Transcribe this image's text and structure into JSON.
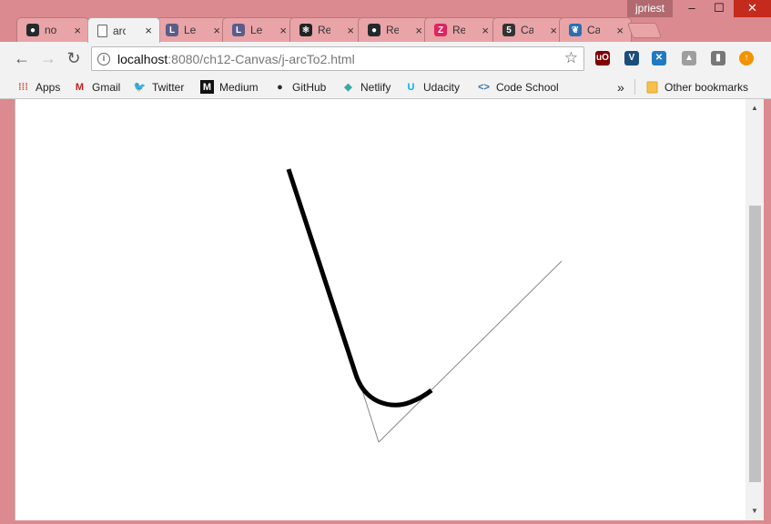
{
  "window": {
    "user": "jpriest",
    "minimize_glyph": "‒",
    "maximize_glyph": "☐",
    "close_glyph": "✕"
  },
  "tabs": [
    {
      "label": "no",
      "icon": "github-icon",
      "color": "#24292e",
      "glyph": "●",
      "active": false
    },
    {
      "label": "arc",
      "icon": "page-icon",
      "color": "#ffffff",
      "glyph": "",
      "active": true
    },
    {
      "label": "Le",
      "icon": "lesson-icon",
      "color": "#5c5c8a",
      "glyph": "L",
      "active": false
    },
    {
      "label": "Le",
      "icon": "lesson-icon",
      "color": "#5c5c8a",
      "glyph": "L",
      "active": false
    },
    {
      "label": "Re",
      "icon": "react-icon",
      "color": "#222222",
      "glyph": "⚛",
      "active": false
    },
    {
      "label": "Re",
      "icon": "github-icon",
      "color": "#24292e",
      "glyph": "●",
      "active": false
    },
    {
      "label": "Re",
      "icon": "nz-icon",
      "color": "#e0245e",
      "glyph": "Z",
      "active": false
    },
    {
      "label": "Ca",
      "icon": "five-icon",
      "color": "#333333",
      "glyph": "5",
      "active": false
    },
    {
      "label": "Ca",
      "icon": "bird-icon",
      "color": "#2a6fb0",
      "glyph": "❦",
      "active": false
    }
  ],
  "tab_close_glyph": "×",
  "toolbar": {
    "back": "←",
    "forward": "→",
    "reload": "↻",
    "url_host": "localhost",
    "url_rest": ":8080/ch12-Canvas/j-arcTo2.html",
    "info": "i",
    "star": "☆",
    "extensions": [
      {
        "name": "ublock-icon",
        "color": "#800000",
        "glyph": "uO"
      },
      {
        "name": "vue-devtools-icon",
        "color": "#1a4d7a",
        "glyph": "V"
      },
      {
        "name": "xcode-icon",
        "color": "#1f7ac2",
        "glyph": "✕"
      },
      {
        "name": "drive-icon",
        "color": "#9e9e9e",
        "glyph": "▲"
      },
      {
        "name": "page-action-icon",
        "color": "#777777",
        "glyph": "▮"
      },
      {
        "name": "update-icon",
        "color": "#f29400",
        "glyph": "↑"
      }
    ]
  },
  "bookmarks": {
    "items": [
      {
        "label": "Apps",
        "icon": "apps-icon",
        "color": "#e04b3c",
        "glyph": "⁞⁞⁞"
      },
      {
        "label": "Gmail",
        "icon": "gmail-icon",
        "color": "#c5221f",
        "glyph": "M"
      },
      {
        "label": "Twitter",
        "icon": "twitter-icon",
        "color": "#1da1f2",
        "glyph": "🐦"
      },
      {
        "label": "Medium",
        "icon": "medium-icon",
        "color": "#111111",
        "glyph": "M"
      },
      {
        "label": "GitHub",
        "icon": "github-icon",
        "color": "#24292e",
        "glyph": "●"
      },
      {
        "label": "Netlify",
        "icon": "netlify-icon",
        "color": "#3aa9a1",
        "glyph": "◆"
      },
      {
        "label": "Udacity",
        "icon": "udacity-icon",
        "color": "#02b3e4",
        "glyph": "U"
      },
      {
        "label": "Code School",
        "icon": "code-school-icon",
        "color": "#2e6fa8",
        "glyph": "<>"
      }
    ],
    "overflow": "»",
    "other": "Other bookmarks",
    "folder_color": "#f5c14b"
  },
  "scrollbar": {
    "up": "▲",
    "down": "▼"
  },
  "canvas": {
    "arc_stroke": "#000000",
    "guide_stroke": "#888888"
  }
}
